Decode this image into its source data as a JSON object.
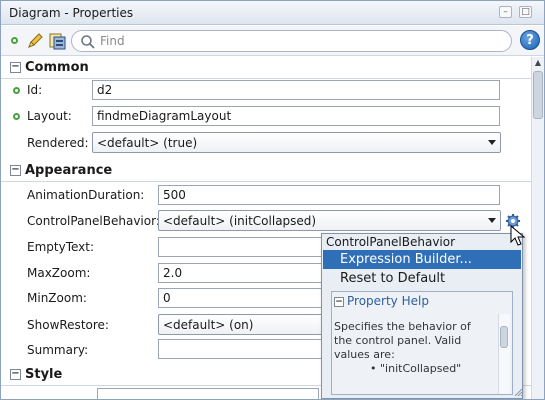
{
  "window": {
    "title": "Diagram - Properties"
  },
  "toolbar": {
    "search_placeholder": "Find",
    "help_label": "?"
  },
  "sections": {
    "common": {
      "label": "Common",
      "id": {
        "label": "Id:",
        "value": "d2"
      },
      "layout": {
        "label": "Layout:",
        "value": "findmeDiagramLayout"
      },
      "rendered": {
        "label": "Rendered:",
        "value": "<default> (true)"
      }
    },
    "appearance": {
      "label": "Appearance",
      "animation_duration": {
        "label": "AnimationDuration:",
        "value": "500"
      },
      "control_panel_behavior": {
        "label": "ControlPanelBehavior:",
        "value": "<default> (initCollapsed)"
      },
      "empty_text": {
        "label": "EmptyText:",
        "value": ""
      },
      "max_zoom": {
        "label": "MaxZoom:",
        "value": "2.0"
      },
      "min_zoom": {
        "label": "MinZoom:",
        "value": "0"
      },
      "show_restore": {
        "label": "ShowRestore:",
        "value": "<default> (on)"
      },
      "summary": {
        "label": "Summary:",
        "value": ""
      }
    },
    "style": {
      "label": "Style"
    }
  },
  "popup": {
    "title": "ControlPanelBehavior",
    "items": [
      "Expression Builder...",
      "Reset to Default"
    ],
    "help_header": "Property Help",
    "help_text": "Specifies the behavior of the control panel. Valid values are:",
    "help_bullet": "\"initCollapsed\""
  },
  "colors": {
    "accent": "#2f6fb7",
    "required_dot": "#4aa040",
    "help_link": "#2b5f9e"
  }
}
